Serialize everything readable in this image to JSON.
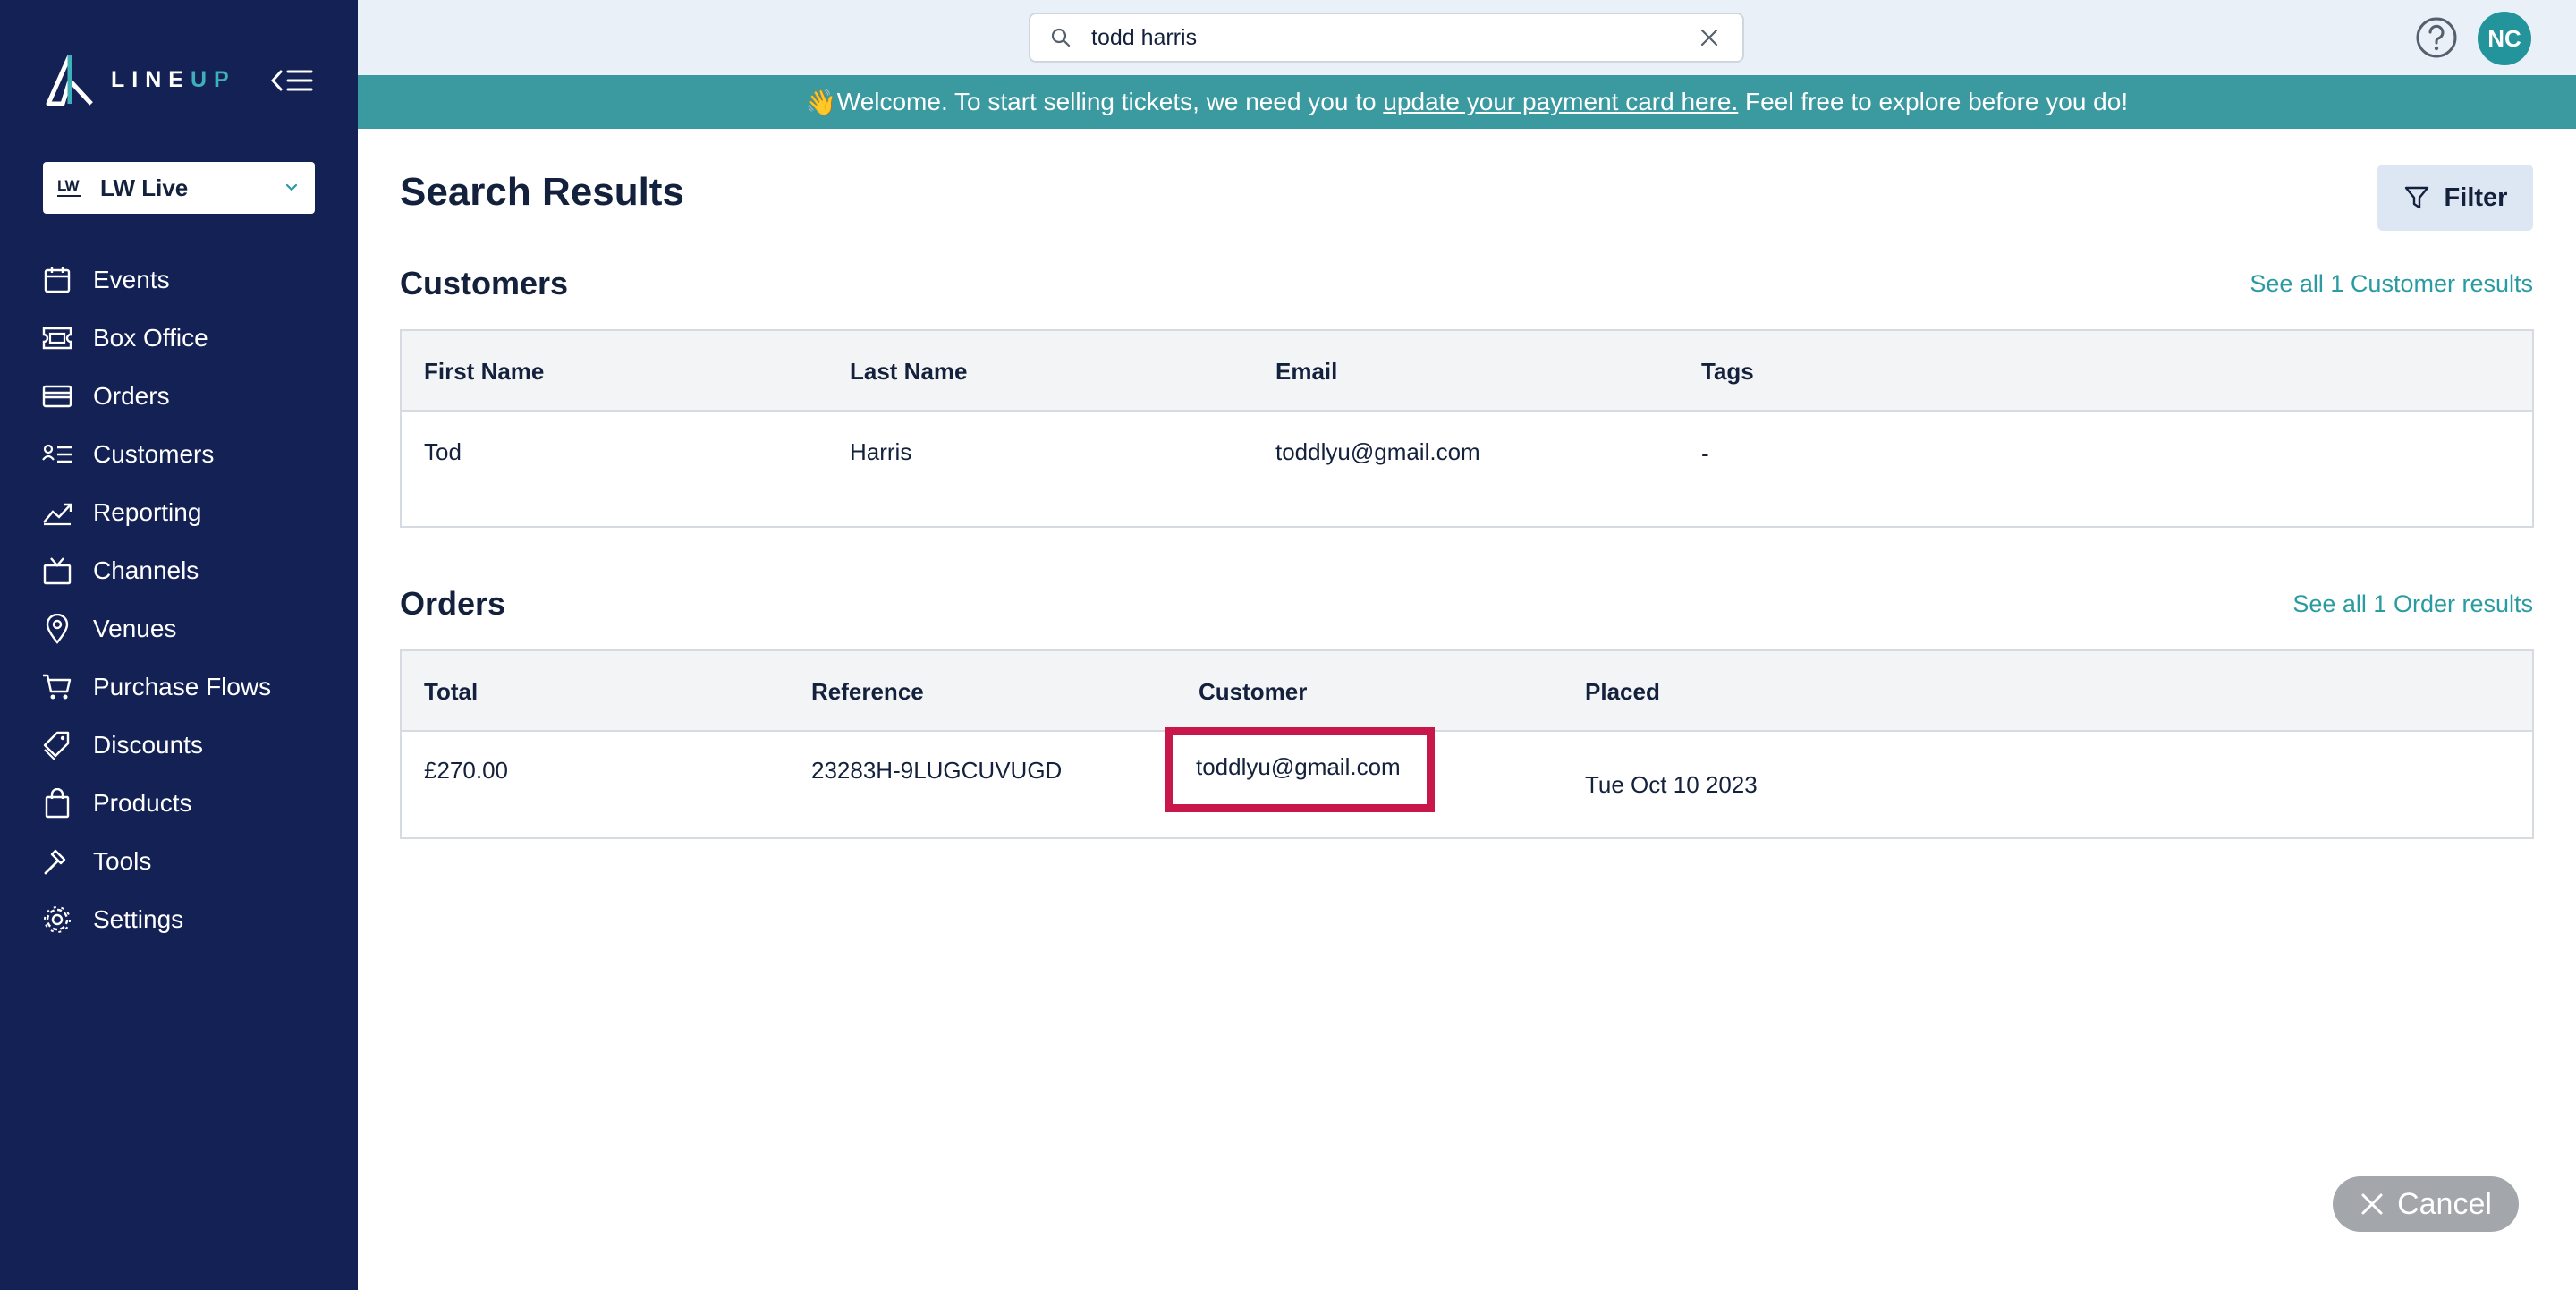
{
  "app": {
    "logo_text_main": "LINE",
    "logo_text_accent": "UP"
  },
  "sidebar": {
    "org": {
      "logo_text": "LW",
      "name": "LW Live"
    },
    "items": [
      {
        "label": "Events",
        "icon": "calendar-icon"
      },
      {
        "label": "Box Office",
        "icon": "ticket-icon"
      },
      {
        "label": "Orders",
        "icon": "credit-card-icon"
      },
      {
        "label": "Customers",
        "icon": "customers-list-icon"
      },
      {
        "label": "Reporting",
        "icon": "trend-chart-icon"
      },
      {
        "label": "Channels",
        "icon": "tv-icon"
      },
      {
        "label": "Venues",
        "icon": "map-pin-icon"
      },
      {
        "label": "Purchase Flows",
        "icon": "shopping-cart-icon"
      },
      {
        "label": "Discounts",
        "icon": "tags-icon"
      },
      {
        "label": "Products",
        "icon": "shopping-bag-icon"
      },
      {
        "label": "Tools",
        "icon": "hammer-icon"
      },
      {
        "label": "Settings",
        "icon": "gear-icon"
      }
    ]
  },
  "topbar": {
    "search_value": "todd harris",
    "avatar_initials": "NC"
  },
  "banner": {
    "emoji": "👋",
    "text_before": "Welcome. To start selling tickets, we need you to ",
    "link_text": "update your payment card here.",
    "text_after": " Feel free to explore before you do!"
  },
  "main": {
    "title": "Search Results",
    "filter_label": "Filter",
    "customers": {
      "title": "Customers",
      "see_all": "See all 1 Customer results",
      "headers": [
        "First Name",
        "Last Name",
        "Email",
        "Tags"
      ],
      "rows": [
        {
          "first_name": "Tod",
          "last_name": "Harris",
          "email": "toddlyu@gmail.com",
          "tags": "-"
        }
      ]
    },
    "orders": {
      "title": "Orders",
      "see_all": "See all 1 Order results",
      "headers": [
        "Total",
        "Reference",
        "Customer",
        "Placed"
      ],
      "rows": [
        {
          "total": "£270.00",
          "reference": "23283H-9LUGCUVUGD",
          "customer": "toddlyu@gmail.com",
          "placed": "Tue Oct 10 2023"
        }
      ]
    }
  },
  "cancel_label": "Cancel",
  "colors": {
    "sidebar_bg": "#142155",
    "accent": "#3a9aa0",
    "highlight": "#c8174b"
  }
}
